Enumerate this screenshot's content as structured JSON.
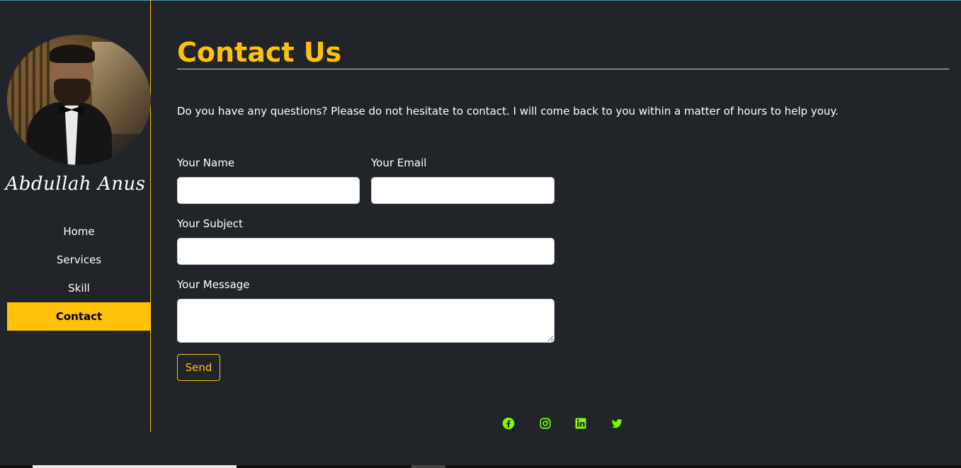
{
  "sidebar": {
    "name": "Abdullah Anus",
    "nav": [
      {
        "label": "Home",
        "active": false
      },
      {
        "label": "Services",
        "active": false
      },
      {
        "label": "Skill",
        "active": false
      },
      {
        "label": "Contact",
        "active": true
      }
    ]
  },
  "main": {
    "title": "Contact Us",
    "intro": "Do you have any questions? Please do not hesitate to contact. I will come back to you within a matter of hours to help youy.",
    "form": {
      "name_label": "Your Name",
      "name_value": "",
      "email_label": "Your Email",
      "email_value": "",
      "subject_label": "Your Subject",
      "subject_value": "",
      "message_label": "Your Message",
      "message_value": "",
      "send_label": "Send"
    },
    "social_icons": [
      "facebook-icon",
      "instagram-icon",
      "linkedin-icon",
      "twitter-icon"
    ]
  },
  "colors": {
    "background": "#212529",
    "accent": "#ffc107",
    "social": "#7cfc00"
  }
}
